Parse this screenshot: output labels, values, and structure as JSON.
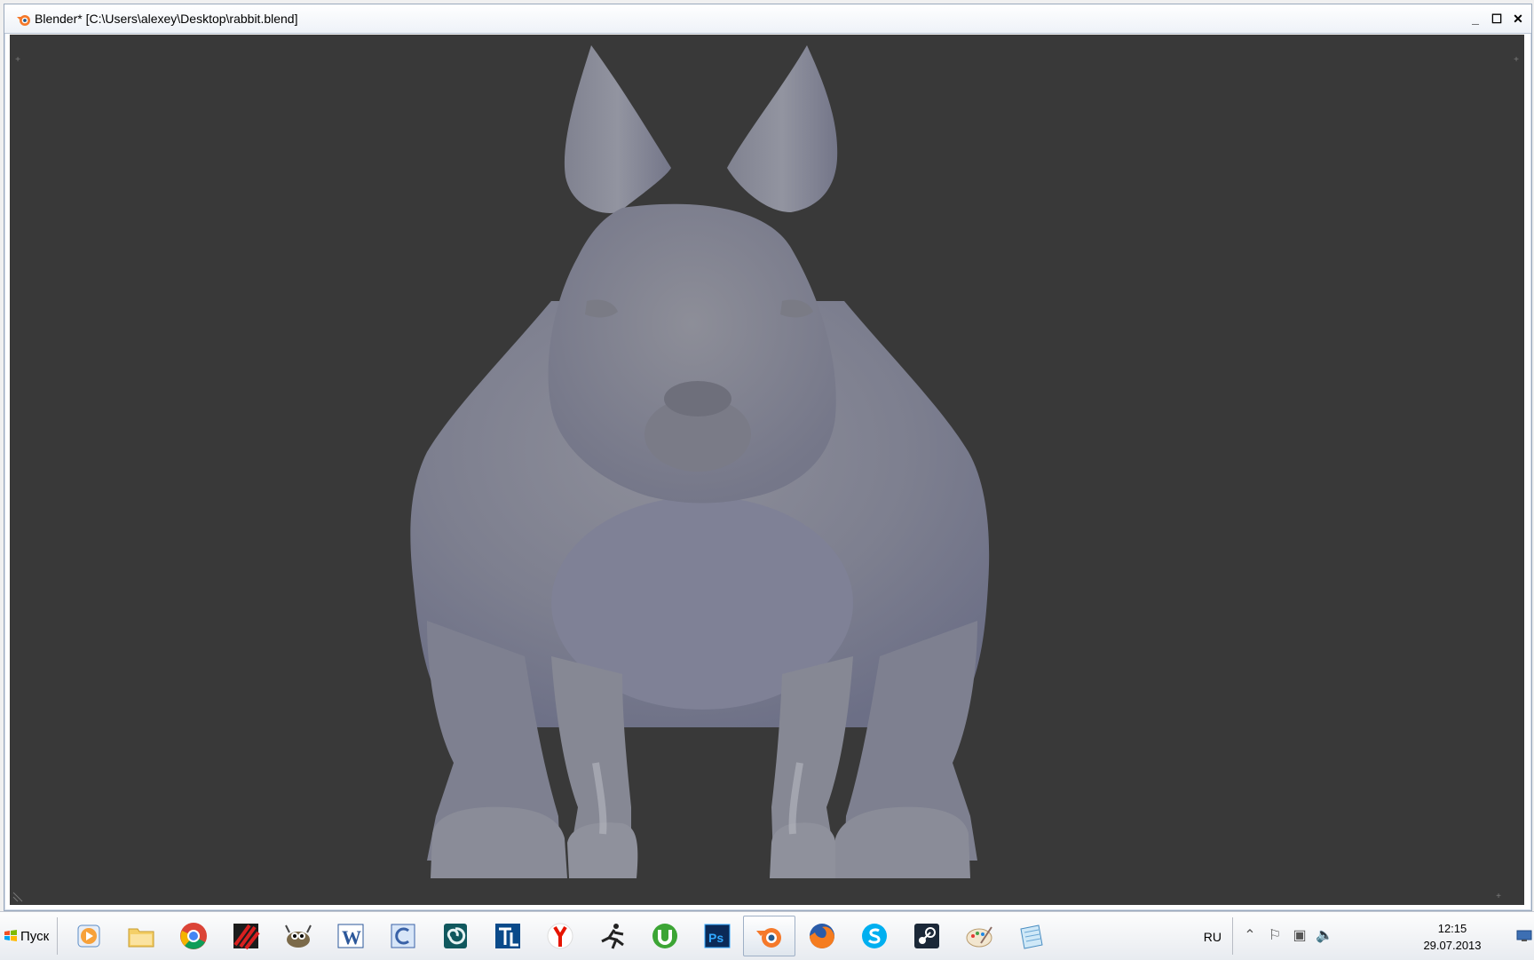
{
  "window": {
    "title": "Blender* [C:\\Users\\alexey\\Desktop\\rabbit.blend]",
    "minimize_glyph": "_",
    "maximize_glyph": "☐",
    "close_glyph": "✕"
  },
  "viewport": {
    "background": "#393939",
    "mesh_color": "#8c8d9a",
    "corner_glyph": "+"
  },
  "taskbar": {
    "start_label": "Пуск",
    "apps": [
      {
        "name": "media-player",
        "icon": "play-icon"
      },
      {
        "name": "file-explorer",
        "icon": "folder-icon"
      },
      {
        "name": "chrome",
        "icon": "chrome-icon"
      },
      {
        "name": "striped-app",
        "icon": "stripes-icon"
      },
      {
        "name": "gimp",
        "icon": "gimp-icon"
      },
      {
        "name": "word",
        "icon": "word-icon"
      },
      {
        "name": "c-app",
        "icon": "c-icon"
      },
      {
        "name": "spiral-app",
        "icon": "spiral-icon"
      },
      {
        "name": "tl-app",
        "icon": "tl-icon"
      },
      {
        "name": "yandex",
        "icon": "yandex-icon"
      },
      {
        "name": "runner-app",
        "icon": "runner-icon"
      },
      {
        "name": "utorrent",
        "icon": "utorrent-icon"
      },
      {
        "name": "photoshop",
        "icon": "photoshop-icon"
      },
      {
        "name": "blender",
        "icon": "blender-icon",
        "active": true
      },
      {
        "name": "firefox",
        "icon": "firefox-icon"
      },
      {
        "name": "skype",
        "icon": "skype-icon"
      },
      {
        "name": "steam",
        "icon": "steam-icon"
      },
      {
        "name": "paint",
        "icon": "paint-icon"
      },
      {
        "name": "notepad",
        "icon": "notepad-icon"
      }
    ],
    "ps_label": "Ps",
    "word_label": "W",
    "language": "RU",
    "time": "12:15",
    "date": "29.07.2013"
  }
}
